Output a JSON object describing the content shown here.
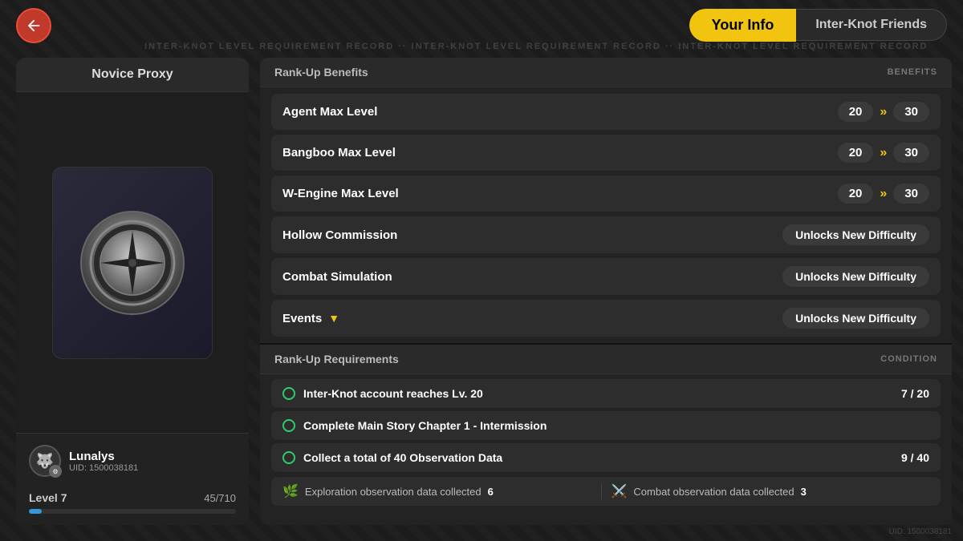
{
  "header": {
    "tab_your_info": "Your Info",
    "tab_friends": "Inter-Knot Friends"
  },
  "left_panel": {
    "rank_title": "Novice Proxy",
    "user_name": "Lunalys",
    "user_uid": "UID: 1500038181",
    "level_label": "Level 7",
    "level_xp": "45/710",
    "xp_percent": 6.3
  },
  "benefits": {
    "section_title": "Rank-Up Benefits",
    "section_label": "BENEFITS",
    "items": [
      {
        "label": "Agent Max Level",
        "from": "20",
        "to": "30",
        "type": "level"
      },
      {
        "label": "Bangboo Max Level",
        "from": "20",
        "to": "30",
        "type": "level"
      },
      {
        "label": "W-Engine Max Level",
        "from": "20",
        "to": "30",
        "type": "level"
      },
      {
        "label": "Hollow Commission",
        "badge": "Unlocks New Difficulty",
        "type": "unlock"
      },
      {
        "label": "Combat Simulation",
        "badge": "Unlocks New Difficulty",
        "type": "unlock"
      },
      {
        "label": "Events",
        "badge": "Unlocks New Difficulty",
        "type": "unlock_dropdown"
      }
    ]
  },
  "requirements": {
    "section_title": "Rank-Up Requirements",
    "section_label": "CONDITION",
    "items": [
      {
        "text": "Inter-Knot account reaches Lv. 20",
        "count": "7 / 20",
        "done": true
      },
      {
        "text": "Complete Main Story Chapter 1 - Intermission",
        "count": "",
        "done": true
      },
      {
        "text": "Collect a total of 40 Observation Data",
        "count": "9 / 40",
        "done": true
      }
    ],
    "observation": {
      "exploration_label": "Exploration observation data collected",
      "exploration_count": "6",
      "combat_label": "Combat observation data collected",
      "combat_count": "3"
    }
  },
  "uid_watermark": "UID: 1500038181",
  "top_bg_text": "INTER-KNOT LEVEL REQUIREMENT RECORD"
}
